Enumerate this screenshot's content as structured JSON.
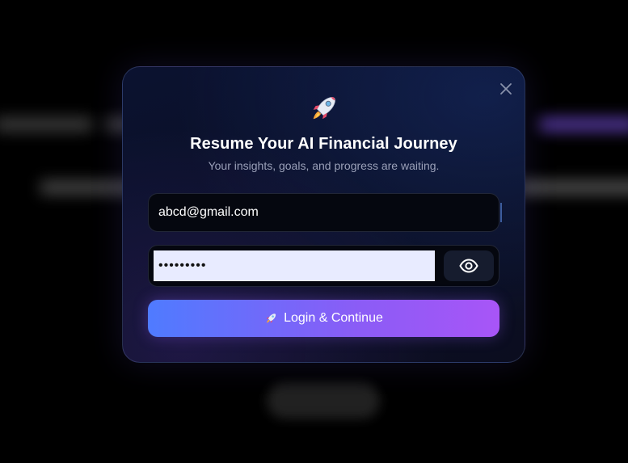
{
  "modal": {
    "title": "Resume Your AI Financial Journey",
    "subtitle": "Your insights, goals, and progress are waiting.",
    "email_value": "abcd@gmail.com",
    "password_value": "•••••••••",
    "login_label": "Login & Continue",
    "icons": {
      "header": "rocket-icon",
      "close": "close-icon",
      "toggle": "eye-icon",
      "button": "rocket-icon"
    }
  },
  "colors": {
    "accent_start": "#4f7bff",
    "accent_end": "#a855f7",
    "title": "#ffffff",
    "subtitle": "#9aa0b8"
  }
}
